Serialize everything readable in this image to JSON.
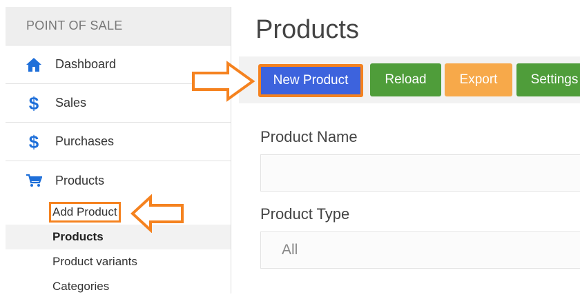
{
  "sidebar": {
    "header": "POINT OF SALE",
    "items": [
      {
        "label": "Dashboard",
        "icon": "home-icon"
      },
      {
        "label": "Sales",
        "icon": "dollar-icon"
      },
      {
        "label": "Purchases",
        "icon": "dollar-icon"
      },
      {
        "label": "Products",
        "icon": "cart-icon"
      }
    ],
    "submenu": [
      "Add Product",
      "Products",
      "Product variants",
      "Categories"
    ],
    "active_submenu": "Products"
  },
  "main": {
    "title": "Products",
    "toolbar": {
      "new_label": "New Product",
      "reload_label": "Reload",
      "export_label": "Export",
      "settings_label": "Settings"
    },
    "filters": {
      "name_label": "Product Name",
      "name_value": "",
      "type_label": "Product Type",
      "type_value": "All"
    }
  },
  "colors": {
    "accent_orange": "#f5821f",
    "primary_blue": "#3d63dd",
    "success_green": "#4f9d3a",
    "warning_orange": "#f7a94a",
    "icon_blue": "#1e6fd9"
  }
}
